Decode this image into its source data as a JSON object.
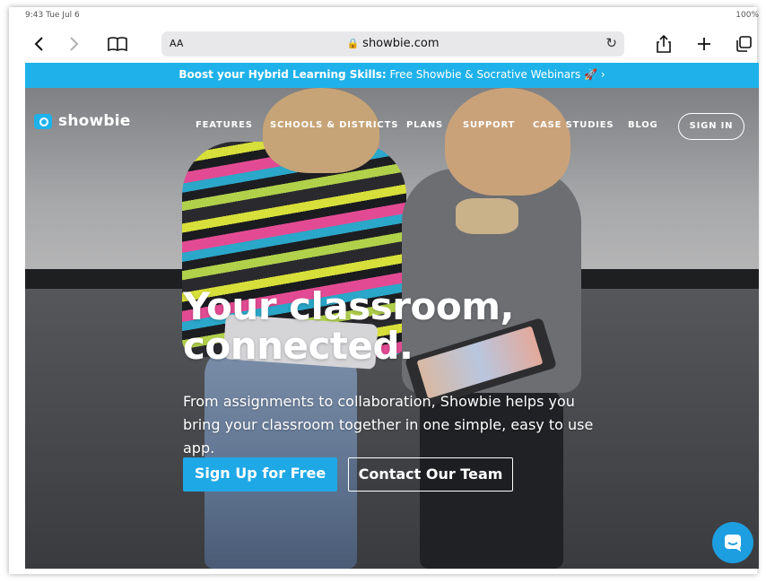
{
  "statusbar": {
    "time": "9:43 Tue Jul 6",
    "right": "100%"
  },
  "toolbar": {
    "back_icon": "chevron-left-icon",
    "forward_icon": "chevron-right-icon",
    "bookmarks_icon": "book-icon",
    "reader_label": "AA",
    "url": "showbie.com",
    "reload_icon": "reload-icon",
    "share_icon": "share-icon",
    "new_tab_icon": "plus-icon",
    "tabs_icon": "tabs-icon"
  },
  "banner": {
    "bold": "Boost your Hybrid Learning Skills:",
    "text": " Free Showbie & Socrative Webinars 🚀 ›",
    "color": "#1fb2ea"
  },
  "nav": {
    "logo": "showbie",
    "items": [
      "FEATURES",
      "SCHOOLS & DISTRICTS",
      "PLANS",
      "SUPPORT",
      "CASE STUDIES",
      "BLOG"
    ],
    "signin": "SIGN IN"
  },
  "hero": {
    "headline_line1": "Your classroom,",
    "headline_line2": "connected.",
    "subtext": "From assignments to collaboration, Showbie helps you bring your classroom together in one simple, easy to use app.",
    "primary_cta": "Sign Up for Free",
    "secondary_cta": "Contact Our Team",
    "accent": "#1fa8e6"
  },
  "chat": {
    "icon": "chat-icon"
  }
}
